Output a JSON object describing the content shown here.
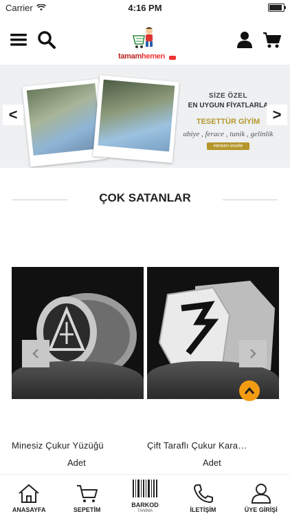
{
  "status": {
    "carrier": "Carrier",
    "time": "4:16 PM",
    "battery_level": 1.0
  },
  "header": {
    "logo_text": "tamamhemen",
    "menu_icon": "hamburger-icon",
    "search_icon": "search-icon",
    "user_icon": "user-icon",
    "cart_icon": "cart-icon"
  },
  "banner": {
    "line1": "SİZE ÖZEL",
    "line2": "EN UYGUN FİYATLARLA",
    "line3": "TESETTÜR GİYİM",
    "line4": "abiye , ferace , tunik , gelinlik",
    "cta": "Hemen incele",
    "prev": "<",
    "next": ">"
  },
  "section": {
    "title": "ÇOK SATANLAR"
  },
  "products": [
    {
      "name": "Minesiz Çukur Yüzüğü",
      "qty_label": "Adet"
    },
    {
      "name": "Çift Taraflı Çukur Kara…",
      "qty_label": "Adet"
    }
  ],
  "tabs": [
    {
      "label": "ANASAYFA",
      "icon": "home-icon"
    },
    {
      "label": "SEPETİM",
      "icon": "cart-icon"
    },
    {
      "label": "BARKOD",
      "sub": "TANIMA",
      "icon": "barcode-icon"
    },
    {
      "label": "İLETİŞİM",
      "icon": "phone-icon"
    },
    {
      "label": "ÜYE GİRİŞİ",
      "icon": "user-icon"
    }
  ],
  "colors": {
    "accent": "#f39c12",
    "gold": "#b5962a",
    "logo_red": "#e33"
  }
}
